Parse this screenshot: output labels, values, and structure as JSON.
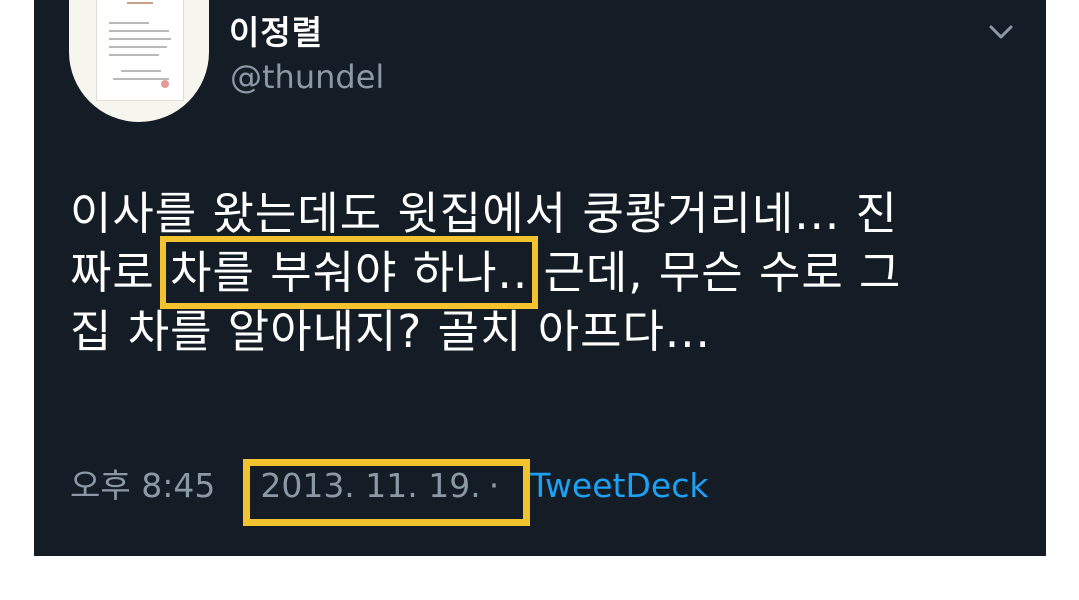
{
  "profile": {
    "display_name": "이정렬",
    "handle": "@thundel",
    "avatar_icon": "certificate-document-icon",
    "menu_icon": "chevron-down-icon"
  },
  "tweet": {
    "lines": [
      {
        "before": "이사를 왔는데도 윗집에서 쿵쾅거리네... 진",
        "highlight": "",
        "after": ""
      },
      {
        "before": "짜로 ",
        "highlight": "차를 부숴야 하나..",
        "after": " 근데, 무슨 수로 그"
      },
      {
        "before": "집 차를 알아내지? 골치 아프다...",
        "highlight": "",
        "after": ""
      }
    ]
  },
  "meta": {
    "time": "오후 8:45",
    "date": "2013. 11. 19.",
    "separator": "·",
    "source": "TweetDeck"
  },
  "colors": {
    "background": "#141c26",
    "text": "#ffffff",
    "muted": "#8b98a5",
    "link": "#1da1f2",
    "highlight_box": "#f2c22f"
  }
}
